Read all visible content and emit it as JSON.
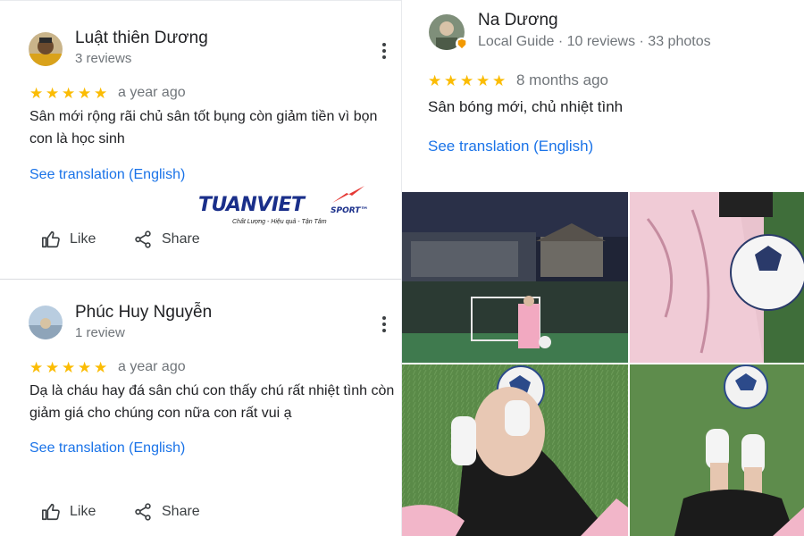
{
  "reviews": [
    {
      "author": "Luật thiên Dương",
      "meta": "3 reviews",
      "stars": 5,
      "when": "a year ago",
      "text": "Sân mới rộng rãi chủ sân tốt bụng còn giảm tiền vì bọn con là học sinh",
      "translate": "See translation (English)",
      "like": "Like",
      "share": "Share"
    },
    {
      "author": "Phúc Huy Nguyễn",
      "meta": "1 review",
      "stars": 5,
      "when": "a year ago",
      "text": "Dạ là cháu hay đá sân chú con thấy chú rất nhiệt tình còn giảm giá cho chúng con nữa con rất vui ạ",
      "translate": "See translation (English)",
      "like": "Like",
      "share": "Share"
    },
    {
      "author": "Na Dương",
      "meta": "Local Guide · 10 reviews · 33 photos",
      "stars": 5,
      "when": "8 months ago",
      "text": "Sân bóng mới, chủ nhiệt tình",
      "translate": "See translation (English)"
    }
  ],
  "logo": {
    "name": "TUANVIET",
    "sub": "SPORT™",
    "tagline": "Chất Lượng - Hiệu quả - Tận Tâm"
  },
  "colors": {
    "star": "#fbbc04",
    "link": "#1a73e8",
    "brand": "#1a2f8a",
    "brand_accent": "#e53935"
  },
  "icons": [
    "more-vert-icon",
    "star-icon",
    "thumb-up-icon",
    "share-icon",
    "local-guide-badge-icon"
  ]
}
